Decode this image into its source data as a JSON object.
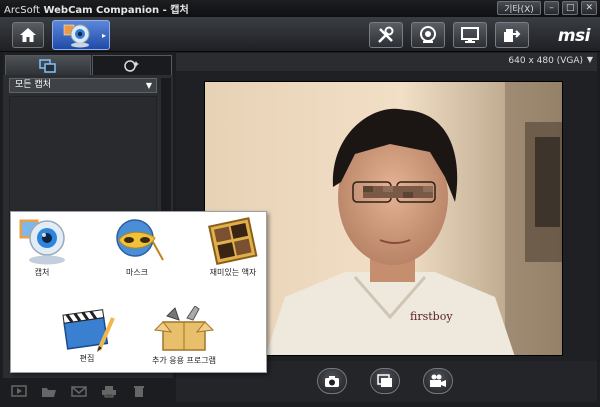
{
  "window": {
    "brand": "ArcSoft",
    "title": "WebCam Companion - 캡처",
    "other_label": "기타(X)",
    "minimize": "–",
    "maximize": "□",
    "close": "✕"
  },
  "toolbar": {
    "logo": "msi",
    "icons": [
      "home-icon",
      "webcam-icon",
      "tools-icon",
      "webcam-settings-icon",
      "monitor-icon",
      "import-icon"
    ]
  },
  "left_panel": {
    "category": "모든 캡처",
    "bottom_icons": [
      "slideshow-icon",
      "open-folder-icon",
      "email-icon",
      "print-icon",
      "delete-icon"
    ]
  },
  "right_panel": {
    "resolution": "640 x 480 (VGA)",
    "capture_buttons": [
      "camera-icon",
      "gallery-icon",
      "video-camera-icon"
    ]
  },
  "popup": {
    "items": [
      {
        "label": "캡처",
        "icon": "webcam-icon"
      },
      {
        "label": "마스크",
        "icon": "mask-icon"
      },
      {
        "label": "재미있는 액자",
        "icon": "frame-icon"
      },
      {
        "label": "편집",
        "icon": "clapboard-icon"
      },
      {
        "label": "추가 응용 프로그램",
        "icon": "box-tools-icon"
      }
    ]
  },
  "colors": {
    "accent": "#2f5fc6",
    "background": "#1b1d20"
  }
}
